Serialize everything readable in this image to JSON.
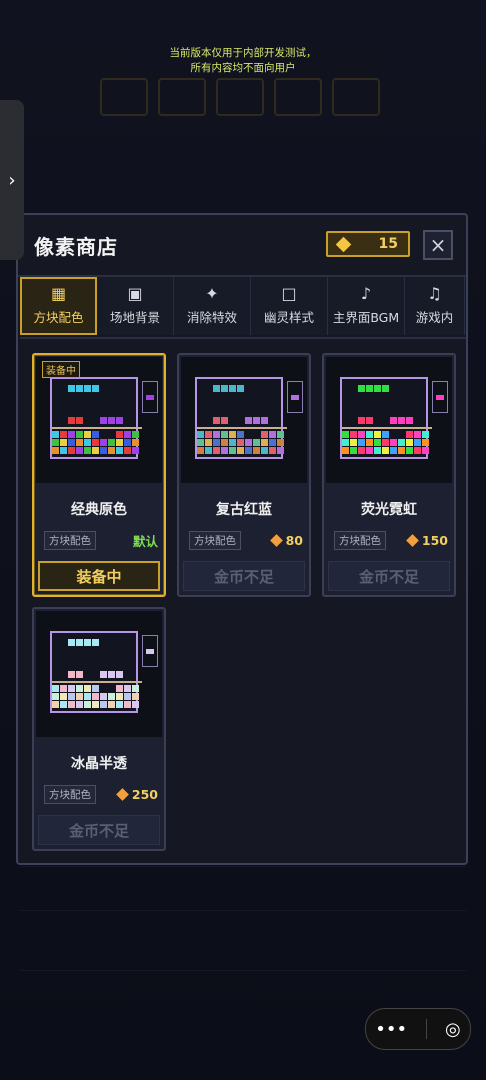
{
  "notice": {
    "line1": "当前版本仅用于内部开发测试，",
    "line2": "所有内容均不面向用户"
  },
  "shop": {
    "title": "像素商店",
    "coins": "15",
    "close_icon": "×"
  },
  "tabs": [
    {
      "label": "方块配色",
      "icon": "▦",
      "active": true
    },
    {
      "label": "场地背景",
      "icon": "▣",
      "active": false
    },
    {
      "label": "消除特效",
      "icon": "✦",
      "active": false
    },
    {
      "label": "幽灵样式",
      "icon": "□",
      "active": false
    },
    {
      "label": "主界面BGM",
      "icon": "♪",
      "active": false
    },
    {
      "label": "游戏内",
      "icon": "♫",
      "active": false
    }
  ],
  "items": [
    {
      "name": "经典原色",
      "tag": "方块配色",
      "price": "",
      "default_label": "默认",
      "badge": "装备中",
      "action": "装备中",
      "state": "equipped",
      "colors": [
        "#3ec8e8",
        "#e83a3a",
        "#a040e8",
        "#40c040",
        "#e8d040",
        "#3a5ae8",
        "#e8902a"
      ]
    },
    {
      "name": "复古红蓝",
      "tag": "方块配色",
      "price": "80",
      "default_label": "",
      "badge": "",
      "action": "金币不足",
      "state": "locked",
      "colors": [
        "#4ab8c8",
        "#e06070",
        "#b070e0",
        "#60c090",
        "#e0b050",
        "#5070d0",
        "#d08040"
      ]
    },
    {
      "name": "荧光霓虹",
      "tag": "方块配色",
      "price": "150",
      "default_label": "",
      "badge": "",
      "action": "金币不足",
      "state": "locked",
      "colors": [
        "#30e040",
        "#ff3a6a",
        "#ff40c0",
        "#40f0d0",
        "#f0f040",
        "#40a0ff",
        "#ff9020"
      ]
    },
    {
      "name": "冰晶半透",
      "tag": "方块配色",
      "price": "250",
      "default_label": "",
      "badge": "",
      "action": "金币不足",
      "state": "locked",
      "colors": [
        "#a8e8f0",
        "#f0b8c8",
        "#d8c8f0",
        "#c8f0d8",
        "#f0e8b8",
        "#b8c8f0",
        "#f0d0b0"
      ]
    }
  ],
  "fab": {
    "more_icon": "•••",
    "record_icon": "◎"
  }
}
